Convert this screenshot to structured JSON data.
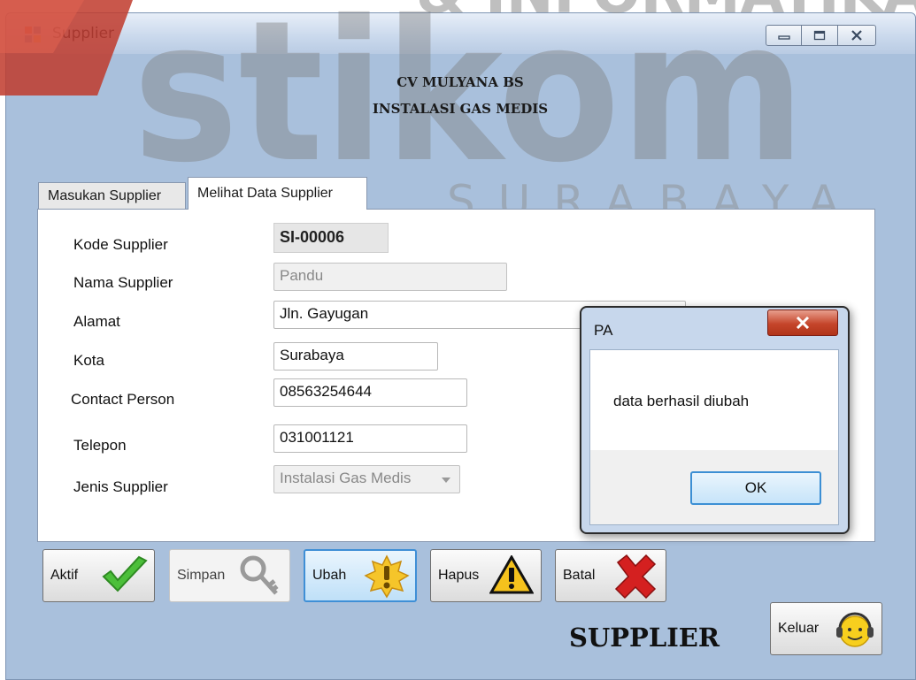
{
  "window": {
    "title": "Supplier",
    "minimize_icon": "minimize-icon",
    "maximize_icon": "maximize-icon",
    "close_icon": "close-icon"
  },
  "watermark": {
    "brand": "stikom",
    "line1": "& INFORMATIKA",
    "line2": "SURABAYA"
  },
  "header": {
    "company": "CV MULYANA BS",
    "subtitle": "INSTALASI GAS MEDIS"
  },
  "tabs": [
    {
      "label": "Masukan Supplier",
      "active": false
    },
    {
      "label": "Melihat Data Supplier",
      "active": true
    }
  ],
  "form": {
    "kode_label": "Kode Supplier",
    "kode_value": "SI-00006",
    "nama_label": "Nama Supplier",
    "nama_value": "Pandu",
    "alamat_label": "Alamat",
    "alamat_value": "Jln. Gayugan",
    "kota_label": "Kota",
    "kota_value": "Surabaya",
    "contact_label": "Contact Person",
    "contact_value": "08563254644",
    "telepon_label": "Telepon",
    "telepon_value": "031001121",
    "jenis_label": "Jenis Supplier",
    "jenis_value": "Instalasi Gas Medis"
  },
  "buttons": {
    "aktif": "Aktif",
    "simpan": "Simpan",
    "ubah": "Ubah",
    "hapus": "Hapus",
    "batal": "Batal",
    "keluar": "Keluar"
  },
  "footer_title": "SUPPLIER",
  "dialog": {
    "title": "PA",
    "message": "data berhasil diubah",
    "ok_label": "OK"
  },
  "colors": {
    "window_bg": "#a9c0dc",
    "watermark": "#8c8c8c",
    "watermark_accent": "#c0392b",
    "focus_blue": "#3f8fd6"
  }
}
